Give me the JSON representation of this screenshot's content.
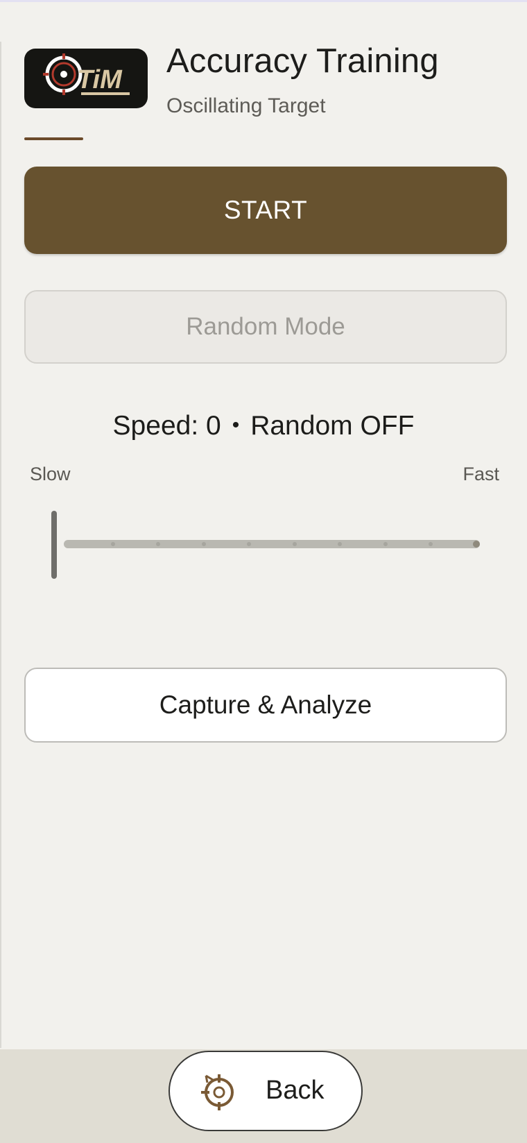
{
  "header": {
    "logo_text": "TiM",
    "title": "Accuracy Training",
    "subtitle": "Oscillating Target"
  },
  "controls": {
    "start_label": "START",
    "random_mode_label": "Random Mode"
  },
  "status": {
    "speed_text": "Speed: 0",
    "separator": "•",
    "random_text": "Random OFF"
  },
  "slider": {
    "min_label": "Slow",
    "max_label": "Fast",
    "value": 0,
    "steps": 10
  },
  "actions": {
    "capture_label": "Capture & Analyze"
  },
  "footer": {
    "back_label": "Back"
  },
  "colors": {
    "accent": "#67522f",
    "background": "#f2f1ed",
    "bottom_bar": "#e0ddd3"
  }
}
